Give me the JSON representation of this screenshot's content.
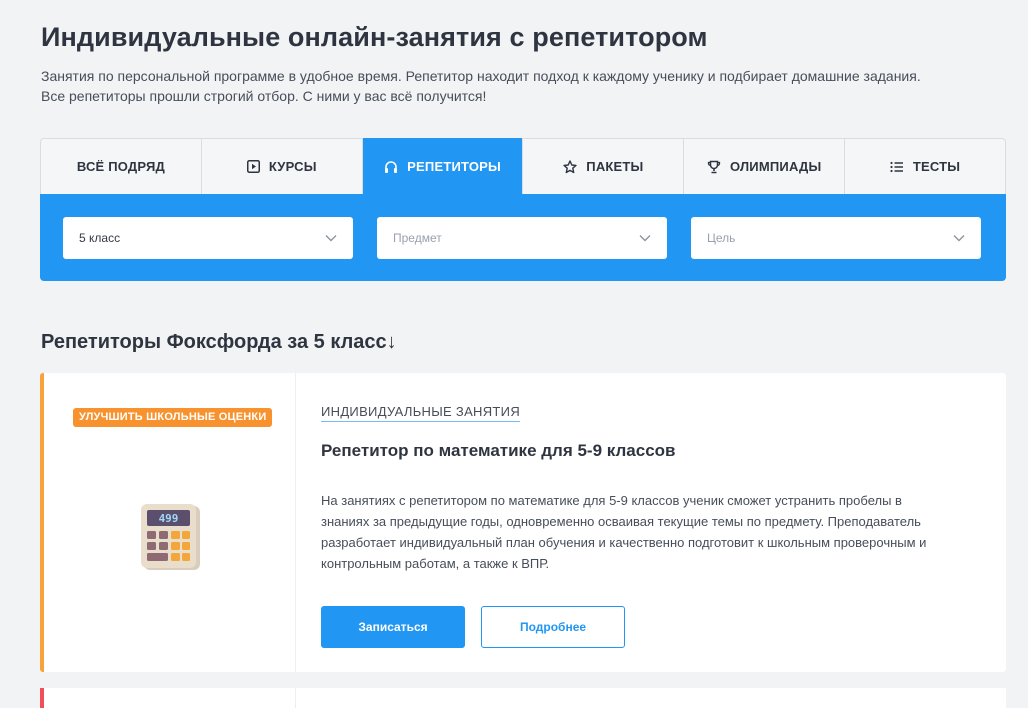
{
  "header": {
    "title": "Индивидуальные онлайн-занятия с репетитором",
    "subtitle_lines": [
      "Занятия по персональной программе в удобное время. Репетитор находит подход к каждому ученику и подбирает домашние задания.",
      "Все репетиторы прошли строгий отбор. С ними у вас всё получится!"
    ]
  },
  "tabs": [
    {
      "label": "ВСЁ ПОДРЯД",
      "icon": "none",
      "active": false
    },
    {
      "label": "КУРСЫ",
      "icon": "play-icon",
      "active": false
    },
    {
      "label": "РЕПЕТИТОРЫ",
      "icon": "headphones-icon",
      "active": true
    },
    {
      "label": "ПАКЕТЫ",
      "icon": "star-icon",
      "active": false
    },
    {
      "label": "ОЛИМПИАДЫ",
      "icon": "trophy-icon",
      "active": false
    },
    {
      "label": "ТЕСТЫ",
      "icon": "list-icon",
      "active": false
    }
  ],
  "filters": {
    "grade": {
      "value": "5 класс"
    },
    "subject": {
      "placeholder": "Предмет"
    },
    "goal": {
      "placeholder": "Цель"
    }
  },
  "section": {
    "title": "Репетиторы Фоксфорда за 5 класс↓"
  },
  "card": {
    "badge": "УЛУЧШИТЬ ШКОЛЬНЫЕ ОЦЕНКИ",
    "image_icon": "calculator-icon",
    "category": "ИНДИВИДУАЛЬНЫЕ ЗАНЯТИЯ",
    "title": "Репетитор по математике для 5-9 классов",
    "description_lines": [
      "На занятиях с репетитором по математике для 5-9 классов ученик сможет устранить пробелы в",
      "знаниях за предыдущие годы, одновременно осваивая текущие темы по предмету. Преподаватель",
      "разработает индивидуальный план обучения и качественно подготовит к школьным проверочным и",
      "контрольным работам, а также к ВПР."
    ],
    "primary_button": "Записаться",
    "secondary_button": "Подробнее"
  },
  "colors": {
    "accent": "#2196f3",
    "badge": "#f7922e",
    "card_stripe": "#f7a23b",
    "next_card_stripe": "#ef4f5a",
    "background": "#f2f3f5"
  }
}
